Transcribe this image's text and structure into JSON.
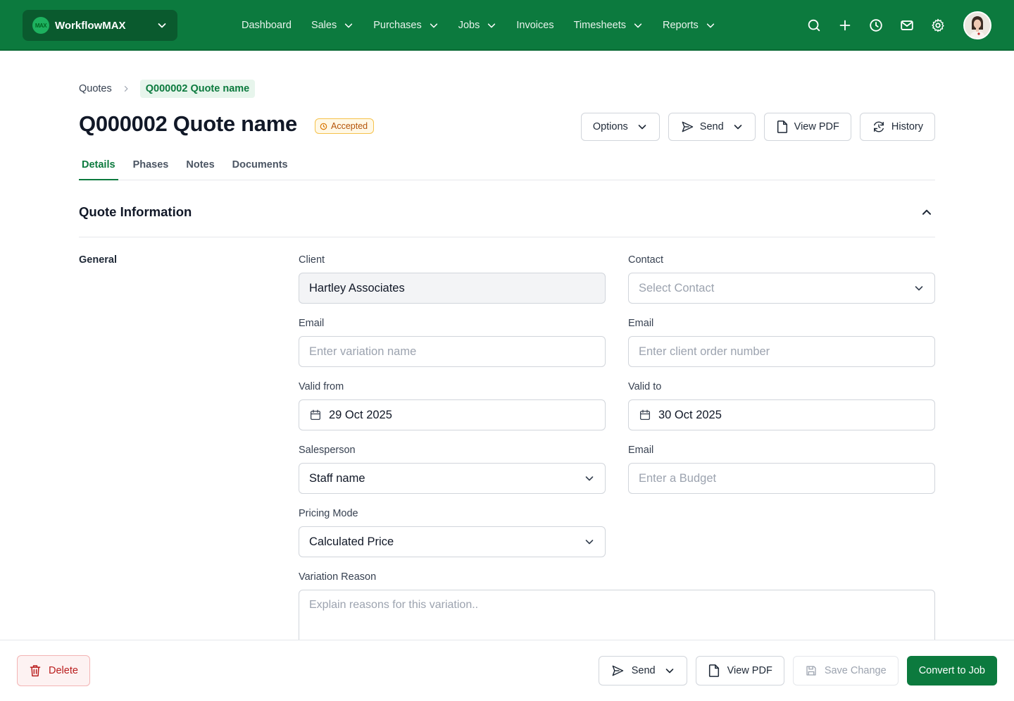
{
  "colors": {
    "brand": "#0c7a3e",
    "accent_badge": "#f5c24b",
    "danger": "#b91c1c"
  },
  "app": {
    "name": "WorkflowMAX",
    "logo_text": "MAX"
  },
  "nav": {
    "items": [
      {
        "label": "Dashboard",
        "has_menu": false
      },
      {
        "label": "Sales",
        "has_menu": true
      },
      {
        "label": "Purchases",
        "has_menu": true
      },
      {
        "label": "Jobs",
        "has_menu": true
      },
      {
        "label": "Invoices",
        "has_menu": false
      },
      {
        "label": "Timesheets",
        "has_menu": true
      },
      {
        "label": "Reports",
        "has_menu": true
      }
    ],
    "icons": [
      "search-icon",
      "plus-icon",
      "clock-icon",
      "mail-icon",
      "gear-icon"
    ]
  },
  "breadcrumb": {
    "parent": "Quotes",
    "current": "Q000002 Quote name"
  },
  "page": {
    "title": "Q000002 Quote name",
    "status": "Accepted",
    "actions": {
      "options": "Options",
      "send": "Send",
      "view_pdf": "View PDF",
      "history": "History"
    }
  },
  "tabs": [
    {
      "label": "Details",
      "active": true
    },
    {
      "label": "Phases",
      "active": false
    },
    {
      "label": "Notes",
      "active": false
    },
    {
      "label": "Documents",
      "active": false
    }
  ],
  "section": {
    "title": "Quote Information",
    "group": "General"
  },
  "form": {
    "client": {
      "label": "Client",
      "value": "Hartley Associates"
    },
    "contact": {
      "label": "Contact",
      "placeholder": "Select Contact"
    },
    "email_left": {
      "label": "Email",
      "placeholder": "Enter variation name"
    },
    "email_right": {
      "label": "Email",
      "placeholder": "Enter client order number"
    },
    "valid_from": {
      "label": "Valid from",
      "value": "29 Oct 2025"
    },
    "valid_to": {
      "label": "Valid to",
      "value": "30 Oct 2025"
    },
    "salesperson": {
      "label": "Salesperson",
      "value": "Staff name"
    },
    "email_budget": {
      "label": "Email",
      "placeholder": "Enter a Budget"
    },
    "pricing_mode": {
      "label": "Pricing Mode",
      "value": "Calculated Price"
    },
    "variation_reason": {
      "label": "Variation Reason",
      "placeholder": "Explain reasons for this variation.."
    }
  },
  "footer": {
    "delete": "Delete",
    "send": "Send",
    "view_pdf": "View PDF",
    "save": "Save Change",
    "convert": "Convert to Job"
  }
}
